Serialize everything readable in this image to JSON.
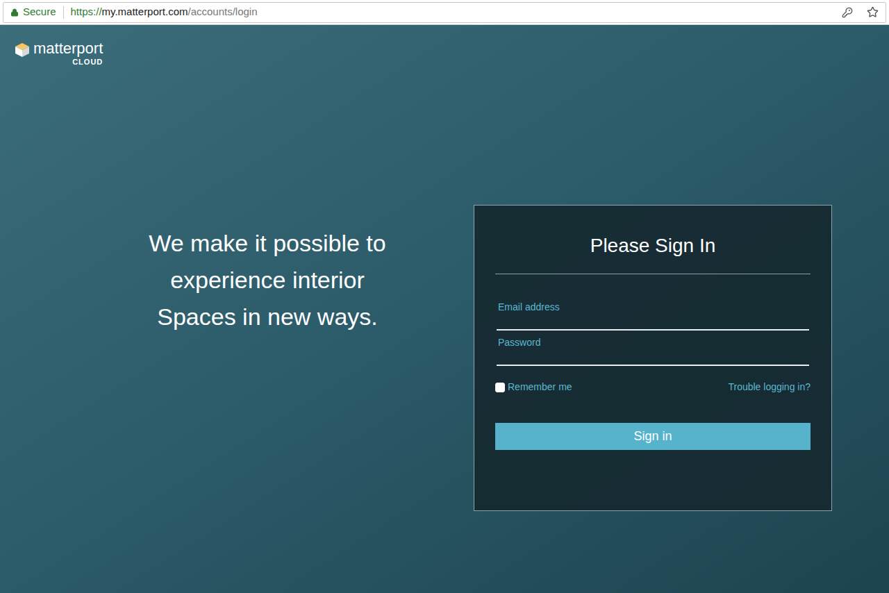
{
  "browser": {
    "secure_label": "Secure",
    "url_scheme": "https://",
    "url_host": "my.matterport.com",
    "url_path": "/accounts/login"
  },
  "logo": {
    "brand": "matterport",
    "sub": "CLOUD"
  },
  "tagline": {
    "lines": [
      "We make it possible to",
      "experience interior",
      "Spaces in new ways."
    ]
  },
  "login": {
    "title": "Please Sign In",
    "fields": [
      {
        "label": "Email address",
        "value": "",
        "kind": "text"
      },
      {
        "label": "Password",
        "value": "",
        "kind": "password"
      }
    ],
    "remember": {
      "label": "Remember me",
      "checked": false
    },
    "trouble_link": "Trouble logging in?",
    "button": "Sign in"
  }
}
